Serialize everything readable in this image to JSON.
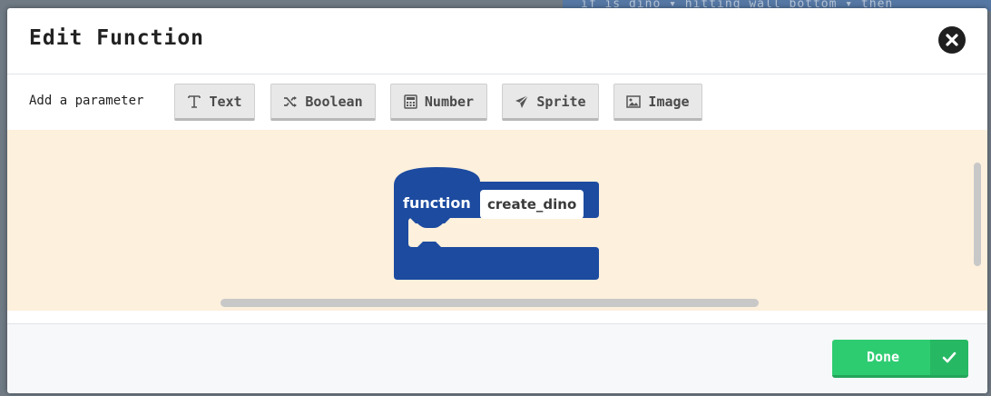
{
  "backdrop": {
    "code_text": "if  is dino ▾ hitting wall  bottom ▾  then"
  },
  "dialog": {
    "title": "Edit Function",
    "close_icon": "close-circle-icon"
  },
  "parameters": {
    "label": "Add a parameter",
    "buttons": [
      {
        "label": "Text",
        "icon": "text-icon"
      },
      {
        "label": "Boolean",
        "icon": "shuffle-icon"
      },
      {
        "label": "Number",
        "icon": "calculator-icon"
      },
      {
        "label": "Sprite",
        "icon": "paper-plane-icon"
      },
      {
        "label": "Image",
        "icon": "image-icon"
      }
    ]
  },
  "block": {
    "keyword": "function",
    "name": "create_dino",
    "color": "#1c4ba0"
  },
  "footer": {
    "done_label": "Done",
    "done_icon": "checkmark-icon",
    "done_color": "#2ecc71"
  }
}
